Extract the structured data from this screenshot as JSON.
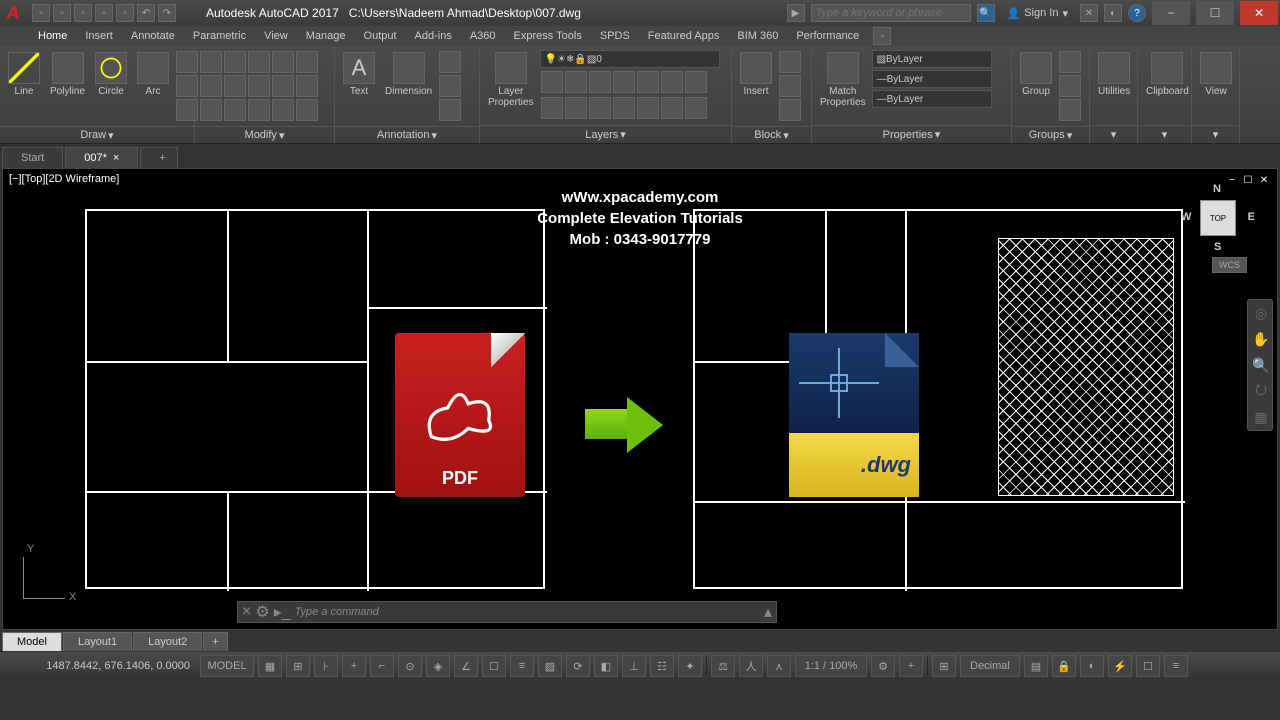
{
  "title": {
    "app": "Autodesk AutoCAD 2017",
    "path": "C:\\Users\\Nadeem Ahmad\\Desktop\\007.dwg"
  },
  "search_placeholder": "Type a keyword or phrase",
  "signin_label": "Sign In",
  "menus": [
    "Home",
    "Insert",
    "Annotate",
    "Parametric",
    "View",
    "Manage",
    "Output",
    "Add-ins",
    "A360",
    "Express Tools",
    "SPDS",
    "Featured Apps",
    "BIM 360",
    "Performance"
  ],
  "panels": {
    "draw": {
      "label": "Draw",
      "items": [
        "Line",
        "Polyline",
        "Circle",
        "Arc"
      ]
    },
    "modify": {
      "label": "Modify"
    },
    "annotation": {
      "label": "Annotation",
      "text": "Text",
      "dim": "Dimension"
    },
    "layers": {
      "label": "Layers",
      "layer_prop": "Layer\nProperties",
      "current": "0"
    },
    "block": {
      "label": "Block",
      "insert": "Insert"
    },
    "properties": {
      "label": "Properties",
      "match": "Match\nProperties",
      "bylayer": "ByLayer"
    },
    "groups": {
      "label": "Groups",
      "group": "Group"
    },
    "utilities": {
      "label": "Utilities"
    },
    "clipboard": {
      "label": "Clipboard"
    },
    "view": {
      "label": "View"
    }
  },
  "doc_tabs": {
    "start": "Start",
    "file": "007*"
  },
  "view_label": "[−][Top][2D Wireframe]",
  "overlay": {
    "line1": "wWw.xpacademy.com",
    "line2": "Complete Elevation Tutorials",
    "line3": "Mob : 0343-9017779"
  },
  "pdf_label": "PDF",
  "dwg_label": ".dwg",
  "viewcube": {
    "face": "TOP",
    "n": "N",
    "s": "S",
    "e": "E",
    "w": "W",
    "wcs": "WCS"
  },
  "ucs": {
    "x": "X",
    "y": "Y"
  },
  "cmd_placeholder": "Type a command",
  "layout_tabs": [
    "Model",
    "Layout1",
    "Layout2"
  ],
  "status": {
    "coords": "1487.8442, 676.1406, 0.0000",
    "model": "MODEL",
    "scale": "1:1 / 100%",
    "units": "Decimal"
  }
}
